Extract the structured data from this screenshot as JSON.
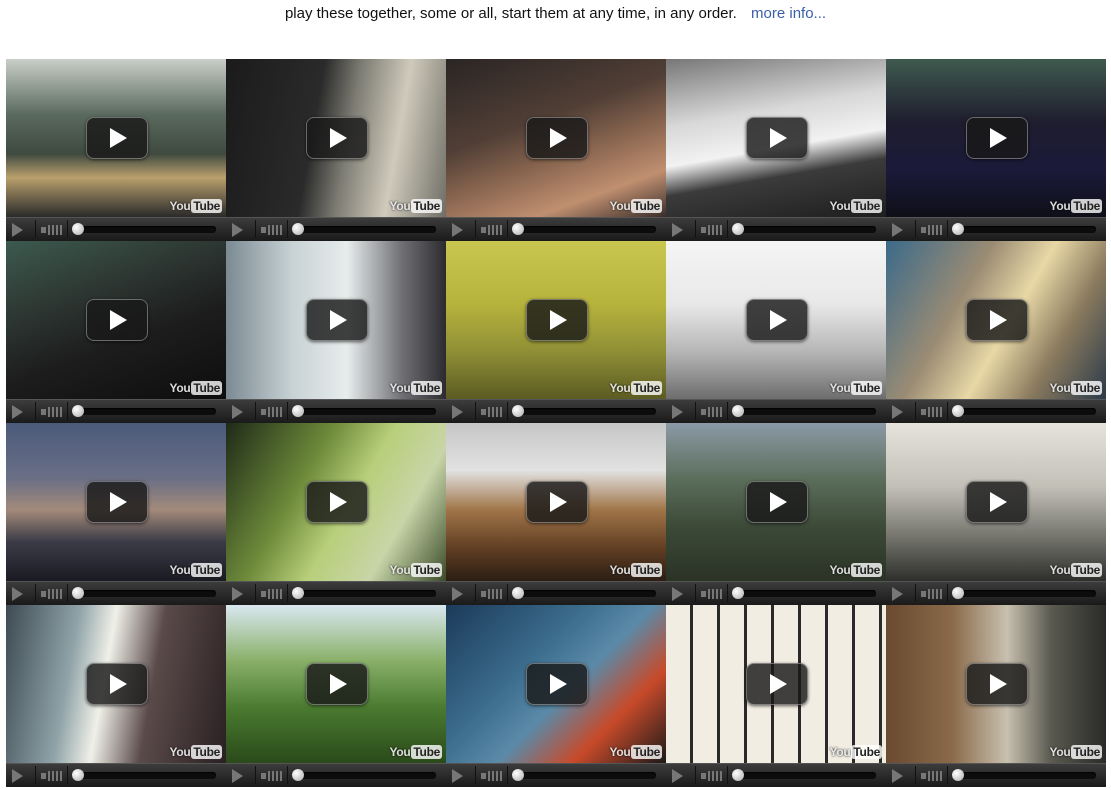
{
  "header": {
    "text": "play these together, some or all, start them at any time, in any order.",
    "more_info": "more info..."
  },
  "player": {
    "logo_you": "You",
    "logo_tube": "Tube"
  },
  "videos": [
    {
      "thumb": "linear-gradient(180deg,#c9cfc9 0%,#5b6a5e 35%,#3f4a40 60%,#b9a06c 75%,#2a2a2a 100%)"
    },
    {
      "thumb": "linear-gradient(100deg,#1b1b1b 0%,#2a2a2a 40%,#7d7c73 55%,#cfcabb 75%,#6f6e66 100%)"
    },
    {
      "thumb": "linear-gradient(160deg,#2a2524 0%,#513f36 40%,#8a6650 60%,#c08f70 80%,#3a2e2a 100%)"
    },
    {
      "thumb": "linear-gradient(170deg,#777 0%,#d8d8d8 35%,#f2f2f2 55%,#3b3b3b 70%,#1e1e1e 100%)"
    },
    {
      "thumb": "linear-gradient(180deg,#3f5a4f 0%,#1e1d2e 40%,#1b1a3a 70%,#0f0f18 100%)"
    },
    {
      "thumb": "linear-gradient(160deg,#3c5a4f 0%,#2f3a35 30%,#1d1d1d 60%,#0d0d0d 100%)"
    },
    {
      "thumb": "linear-gradient(90deg,#7b8a93 0%,#c8d2d4 30%,#e7ecec 55%,#6f6f74 80%,#2b2b30 100%)"
    },
    {
      "thumb": "linear-gradient(180deg,#c9c74f 0%,#b6b33c 40%,#8f8f36 70%,#5b5b23 100%)"
    },
    {
      "thumb": "linear-gradient(180deg,#f5f5f5 0%,#e8e8e8 40%,#b6b6b6 70%,#6d6d6d 100%)"
    },
    {
      "thumb": "linear-gradient(120deg,#3b6a8a 0%,#9b8c74 35%,#e8d8a6 55%,#8a7a5e 75%,#2a3a4a 100%)"
    },
    {
      "thumb": "linear-gradient(180deg,#4a5a7a 0%,#6a6f86 35%,#a38a7a 55%,#3c3c48 75%,#1a1a22 100%)"
    },
    {
      "thumb": "linear-gradient(120deg,#1e2a18 0%,#6d8a3a 35%,#b8cf7a 55%,#c8d5a8 75%,#3b4a2a 100%)"
    },
    {
      "thumb": "linear-gradient(180deg,#c6c6c6 0%,#e2e2e2 30%,#a07548 55%,#5f3d22 80%,#2b1e14 100%)"
    },
    {
      "thumb": "linear-gradient(180deg,#8b9aa6 0%,#5c6f5c 35%,#3d4a38 65%,#2a3326 100%)"
    },
    {
      "thumb": "linear-gradient(180deg,#e6e3dc 0%,#c3c0b8 40%,#7a7a72 70%,#2e2e2b 100%)"
    },
    {
      "thumb": "linear-gradient(100deg,#3d4a52 0%,#8fa3a8 30%,#f0f0e8 45%,#5a4a4a 65%,#2a2022 100%)"
    },
    {
      "thumb": "linear-gradient(180deg,#d9e8f0 0%,#8ab06a 35%,#4a7a30 65%,#2a4a1a 100%)"
    },
    {
      "thumb": "linear-gradient(135deg,#1c3a5a 0%,#3a6a8a 35%,#5a8aa8 55%,#c84a2a 75%,#1a1a1a 100%)"
    },
    {
      "thumb": "repeating-linear-gradient(90deg,#f2ede2 0 24px,#2a2a2a 24px 27px)"
    },
    {
      "thumb": "linear-gradient(90deg,#6a4a30 0%,#8a6a4a 30%,#c8c0b0 55%,#5a5a50 75%,#2a2a28 100%)"
    }
  ]
}
